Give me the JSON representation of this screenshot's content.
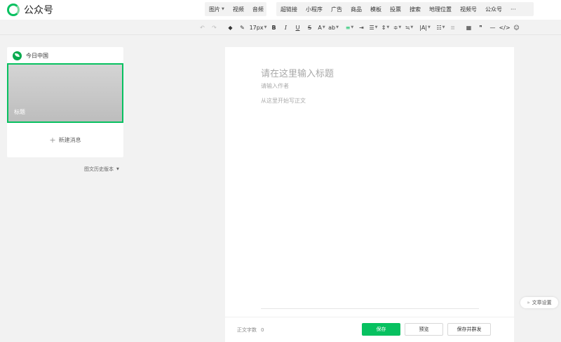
{
  "header": {
    "logo_text": "公众号",
    "media_menu": [
      {
        "label": "图片",
        "has_caret": true
      },
      {
        "label": "视频",
        "has_caret": false
      },
      {
        "label": "音频",
        "has_caret": false
      }
    ],
    "insert_menu": [
      {
        "label": "超链接"
      },
      {
        "label": "小程序"
      },
      {
        "label": "广告"
      },
      {
        "label": "商品"
      },
      {
        "label": "模板"
      },
      {
        "label": "投票"
      },
      {
        "label": "搜索"
      },
      {
        "label": "地理位置"
      },
      {
        "label": "视频号"
      },
      {
        "label": "公众号"
      },
      {
        "label": "···"
      }
    ]
  },
  "toolbar": {
    "undo_icon": "↶",
    "redo_icon": "↷",
    "format_painter_icon": "◆",
    "clear_format_icon": "✎",
    "font_size": "17px",
    "bold": "B",
    "italic": "I",
    "underline": "U",
    "strike": "S",
    "font_color": "A",
    "bg_color": "ab",
    "align_icon": "≡",
    "indent_icon": "⇥",
    "line_height_icon": "☰",
    "spacing_icon": "⇕",
    "para_before_icon": "≑",
    "para_after_icon": "≒",
    "letter_spacing_icon": "|A|",
    "list_icon": "☷",
    "disabled_icon": "≣",
    "table_icon": "▦",
    "quote_icon": "❞",
    "hr_icon": "—",
    "code_icon": "</>",
    "emoji_icon": "☺"
  },
  "left_panel": {
    "account_name": "今日中国",
    "article_title_placeholder": "标题",
    "new_message_label": "新建消息",
    "history_label": "图文历史版本"
  },
  "editor": {
    "title_placeholder": "请在这里输入标题",
    "author_placeholder": "请输入作者",
    "body_placeholder": "从这里开始写正文"
  },
  "footer": {
    "word_count_label": "正文字数",
    "word_count_value": "0",
    "save_label": "保存",
    "preview_label": "预览",
    "save_send_label": "保存并群发"
  },
  "float": {
    "settings_label": "文章设置"
  },
  "colors": {
    "accent": "#07c160"
  }
}
